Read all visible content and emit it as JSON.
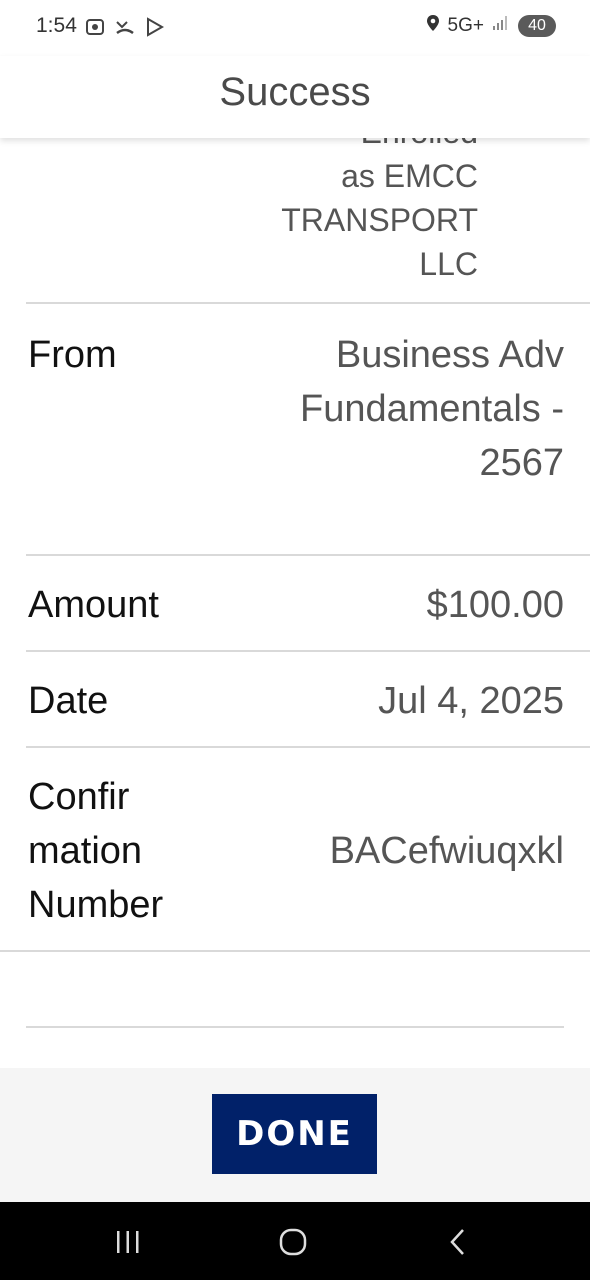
{
  "status_bar": {
    "time": "1:54",
    "network": "5G+",
    "battery": "40"
  },
  "header": {
    "title": "Success"
  },
  "details": {
    "enrolled_lines": [
      "Enrolled",
      "as EMCC",
      "TRANSPORT",
      "LLC"
    ],
    "rows": [
      {
        "label_lines": [
          "From"
        ],
        "value_lines": [
          "Business Adv",
          "Fundamentals -",
          "2567"
        ]
      },
      {
        "label_lines": [
          "Amount"
        ],
        "value_lines": [
          "$100.00"
        ]
      },
      {
        "label_lines": [
          "Date"
        ],
        "value_lines": [
          "Jul 4, 2025"
        ]
      },
      {
        "label_lines": [
          "Confir",
          "mation",
          "Number"
        ],
        "value_lines": [
          "BACefwiuqxkl"
        ]
      }
    ]
  },
  "footer": {
    "done_label": "DONE"
  },
  "colors": {
    "done_bg": "#012169"
  }
}
